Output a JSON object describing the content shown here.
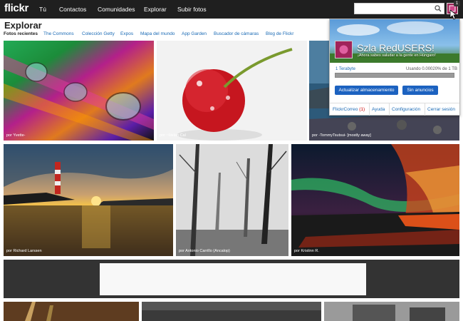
{
  "header": {
    "logo": "flickr",
    "nav": [
      "Tú",
      "Contactos",
      "Comunidades",
      "Explorar",
      "Subir fotos"
    ],
    "notification_count": "1"
  },
  "page": {
    "title": "Explorar",
    "subnav": [
      "Fotos recientes",
      "The Commons",
      "Colección Getty",
      "Expos",
      "Mapa del mundo",
      "App Garden",
      "Buscador de cámaras",
      "Blog de Flickr"
    ]
  },
  "photos": [
    {
      "credit": "por Yvette-"
    },
    {
      "credit": "por ~Helen Cal"
    },
    {
      "credit": "por -TommyTsutsui- [mostly away]"
    },
    {
      "credit": "por Richard Larssen"
    },
    {
      "credit": "por Antonio Carrillo (Ancalop)"
    },
    {
      "credit": "por Kristinn R."
    }
  ],
  "profile_panel": {
    "name": "Szla RedUSERS!",
    "greeting": "¡Ahora sabes saludar a la gente en Húngaro!",
    "storage_label": "1 Terabyte",
    "storage_usage": "Usando 0.00020% de 1 TB",
    "storage_fraction": 2e-06,
    "upgrade_button": "Actualizar almacenamiento",
    "no_ads_button": "Sin anuncios",
    "footer": {
      "mail_label": "FlickrCorreo",
      "mail_count": "(1)",
      "help": "Ayuda",
      "settings": "Configuración",
      "logout": "Cerrar sesión"
    }
  },
  "colors": {
    "topbar": "#1f1f1f",
    "link": "#1a6ab5",
    "button": "#1c62c0"
  }
}
